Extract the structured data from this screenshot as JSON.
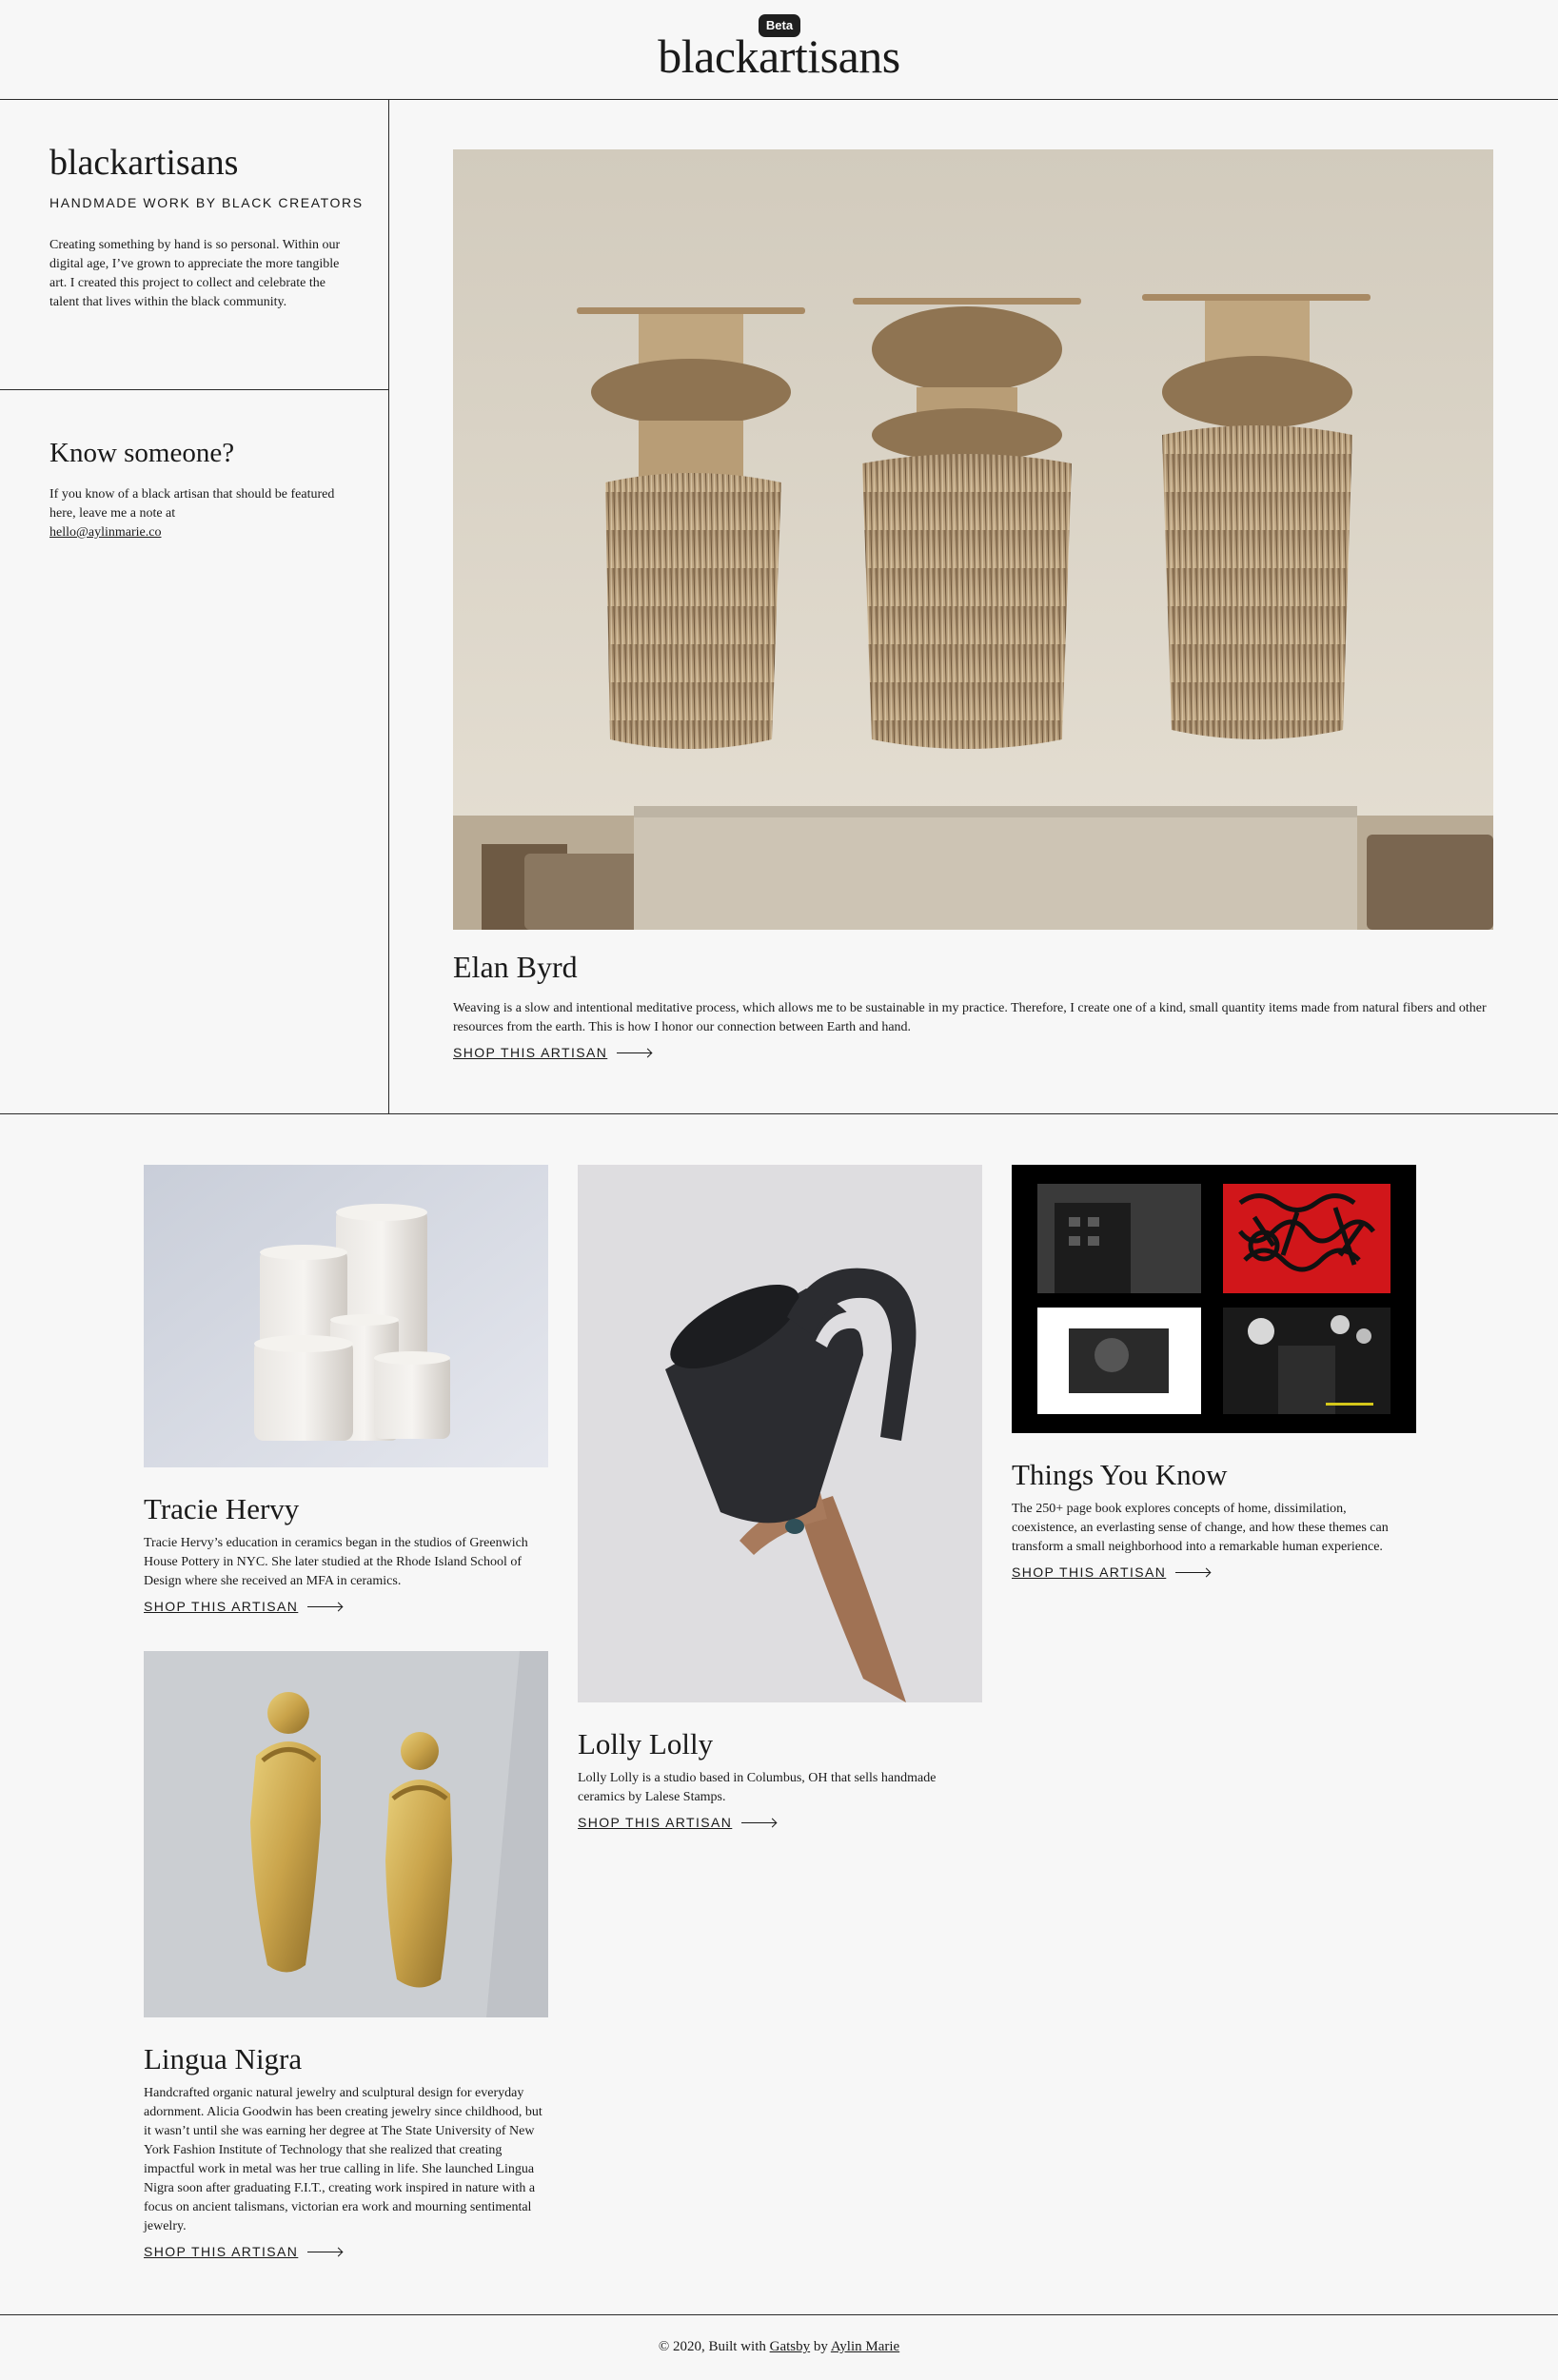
{
  "header": {
    "beta_label": "Beta",
    "site_title": "blackartisans"
  },
  "about": {
    "title": "blackartisans",
    "tagline": "HANDMADE WORK BY BLACK CREATORS",
    "body": "Creating something by hand is so personal. Within our digital age, I’ve grown to appreciate the more tangible art. I created this project to collect and celebrate the talent that lives within the black community."
  },
  "know": {
    "title": "Know someone?",
    "body": "If you know of a black artisan that should be featured here, leave me a note at",
    "email": "hello@aylinmarie.co"
  },
  "featured": {
    "name": "Elan Byrd",
    "description": "Weaving is a slow and intentional meditative process, which allows me to be sustainable in my practice. Therefore, I create one of a kind, small quantity items made from natural fibers and other resources from the earth. This is how I honor our connection between Earth and hand.",
    "shop_label": "SHOP THIS ARTISAN"
  },
  "artisans": [
    {
      "name": "Tracie Hervy",
      "description": "Tracie Hervy’s education in ceramics began in the studios of Greenwich House Pottery in NYC. She later studied at the Rhode Island School of Design where she received an MFA in ceramics.",
      "shop_label": "SHOP THIS ARTISAN"
    },
    {
      "name": "Lolly Lolly",
      "description": "Lolly Lolly is a studio based in Columbus, OH that sells handmade ceramics by Lalese Stamps.",
      "shop_label": "SHOP THIS ARTISAN"
    },
    {
      "name": "Things You Know",
      "description": "The 250+ page book explores concepts of home, dissimilation, coexistence, an everlasting sense of change, and how these themes can transform a small neighborhood into a remarkable human experience.",
      "shop_label": "SHOP THIS ARTISAN"
    },
    {
      "name": "Lingua Nigra",
      "description": "Handcrafted organic natural jewelry and sculptural design for everyday adornment. Alicia Goodwin has been creating jewelry since childhood, but it wasn’t until she was earning her degree at The State University of New York Fashion Institute of Technology that she realized that creating impactful work in metal was her true calling in life. She launched Lingua Nigra soon after graduating F.I.T., creating work inspired in nature with a focus on ancient talismans, victorian era work and mourning sentimental jewelry.",
      "shop_label": "SHOP THIS ARTISAN"
    }
  ],
  "footer": {
    "prefix": "© 2020, Built with",
    "gatsby_label": "Gatsby",
    "by_label": "by",
    "author_label": "Aylin Marie"
  }
}
